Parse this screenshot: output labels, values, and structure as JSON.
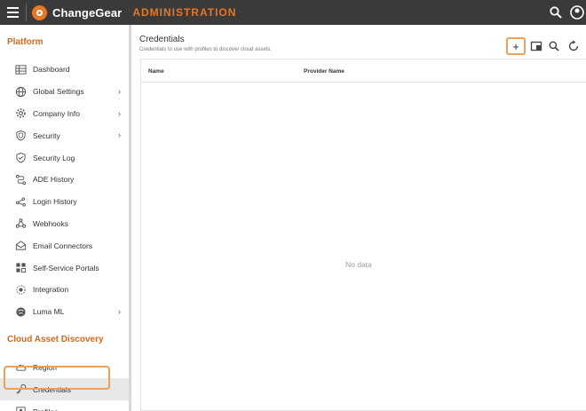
{
  "header": {
    "brand": "ChangeGear",
    "section": "ADMINISTRATION",
    "search_icon": "search-icon",
    "user_icon": "user-icon"
  },
  "sidebar": {
    "sections": [
      {
        "title": "Platform",
        "items": [
          {
            "label": "Dashboard",
            "icon": "table-icon",
            "chevron": false
          },
          {
            "label": "Global Settings",
            "icon": "globe-icon",
            "chevron": true
          },
          {
            "label": "Company Info",
            "icon": "gear-icon",
            "chevron": true
          },
          {
            "label": "Security",
            "icon": "shield-icon",
            "chevron": true
          },
          {
            "label": "Security Log",
            "icon": "shield-check-icon",
            "chevron": false
          },
          {
            "label": "ADE History",
            "icon": "flow-icon",
            "chevron": false
          },
          {
            "label": "Login History",
            "icon": "network-icon",
            "chevron": false
          },
          {
            "label": "Webhooks",
            "icon": "webhook-icon",
            "chevron": false
          },
          {
            "label": "Email Connectors",
            "icon": "email-icon",
            "chevron": false
          },
          {
            "label": "Self-Service Portals",
            "icon": "grid-icon",
            "chevron": false
          },
          {
            "label": "Integration",
            "icon": "integration-icon",
            "chevron": false
          },
          {
            "label": "Luma ML",
            "icon": "brain-icon",
            "chevron": true
          }
        ]
      },
      {
        "title": "Cloud Asset Discovery",
        "items": [
          {
            "label": "Region",
            "icon": "cloud-icon",
            "chevron": false
          },
          {
            "label": "Credentials",
            "icon": "key-icon",
            "chevron": false,
            "active": true
          },
          {
            "label": "Profiles",
            "icon": "profile-icon",
            "chevron": false
          }
        ]
      }
    ]
  },
  "main": {
    "title": "Credentials",
    "subtitle": "Credentials to use with profiles to discover cloud assets.",
    "add_label": "+",
    "table": {
      "columns": [
        "Name",
        "Provider Name"
      ],
      "empty_text": "No data"
    }
  }
}
